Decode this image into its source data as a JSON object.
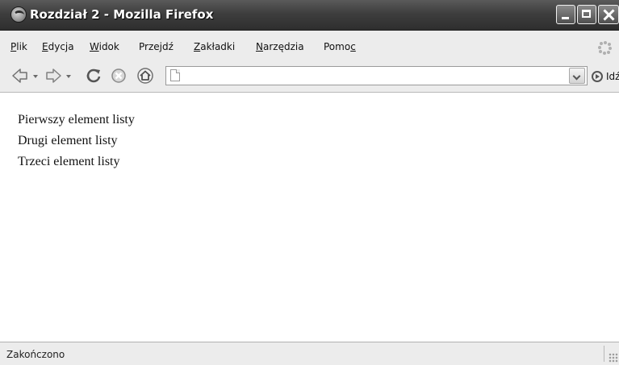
{
  "window": {
    "title": "Rozdział 2 - Mozilla Firefox",
    "icon": "firefox-icon",
    "controls": [
      "minimize-icon",
      "maximize-icon",
      "close-icon"
    ]
  },
  "menu": {
    "items": [
      {
        "before": "",
        "underline": "P",
        "after": "lik"
      },
      {
        "before": "",
        "underline": "E",
        "after": "dycja"
      },
      {
        "before": "",
        "underline": "W",
        "after": "idok"
      },
      {
        "before": "Prze",
        "underline": "j",
        "after": "dź"
      },
      {
        "before": "",
        "underline": "Z",
        "after": "akładki"
      },
      {
        "before": "",
        "underline": "N",
        "after": "arzędzia"
      },
      {
        "before": "Pomo",
        "underline": "c",
        "after": ""
      }
    ]
  },
  "navigation": {
    "icons": [
      "back-arrow-icon",
      "forward-arrow-icon",
      "reload-icon",
      "stop-icon",
      "home-icon"
    ],
    "url": {
      "value": "",
      "placeholder": ""
    },
    "go_label": "Idź"
  },
  "content": {
    "list_items": [
      "Pierwszy element listy",
      "Drugi element listy",
      "Trzeci element listy"
    ]
  },
  "status": {
    "text": "Zakończono"
  }
}
